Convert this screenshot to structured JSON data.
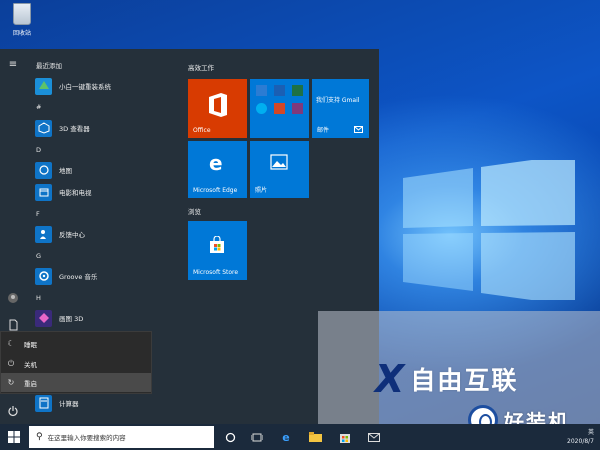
{
  "desktop": {
    "recycle_bin_label": "回收站"
  },
  "start_menu": {
    "recent_header": "最近添加",
    "recent_app": "小白一键重装系统",
    "groups": [
      {
        "letter": "#",
        "apps": [
          "3D 查看器"
        ]
      },
      {
        "letter": "D",
        "apps": [
          "地图",
          "电影和电视"
        ]
      },
      {
        "letter": "F",
        "apps": [
          "反馈中心"
        ]
      },
      {
        "letter": "G",
        "apps": [
          "Groove 音乐"
        ]
      },
      {
        "letter": "H",
        "apps": [
          "画图 3D"
        ]
      }
    ],
    "bottom_app": "计算器",
    "tile_sections": {
      "productivity": "高效工作",
      "browse": "浏览"
    },
    "tiles": {
      "office": "Office",
      "gmail_text": "我们支持 Gmail",
      "mail": "邮件",
      "edge": "Microsoft Edge",
      "photos": "照片",
      "store": "Microsoft Store"
    },
    "power_menu": {
      "items": [
        "睡眠",
        "关机",
        "重启"
      ]
    }
  },
  "watermark": {
    "brand_letter": "X",
    "brand_text": "自由互联",
    "second_text": "好装机"
  },
  "taskbar": {
    "search_placeholder": "在这里输入你要搜索的内容",
    "tray_line1": "英",
    "tray_date": "2020/8/7"
  },
  "colors": {
    "office_tile": "#d83b01",
    "tile_blue": "#0078d7",
    "menu_bg": "#25303a",
    "taskbar_bg": "#1b2a3c"
  }
}
